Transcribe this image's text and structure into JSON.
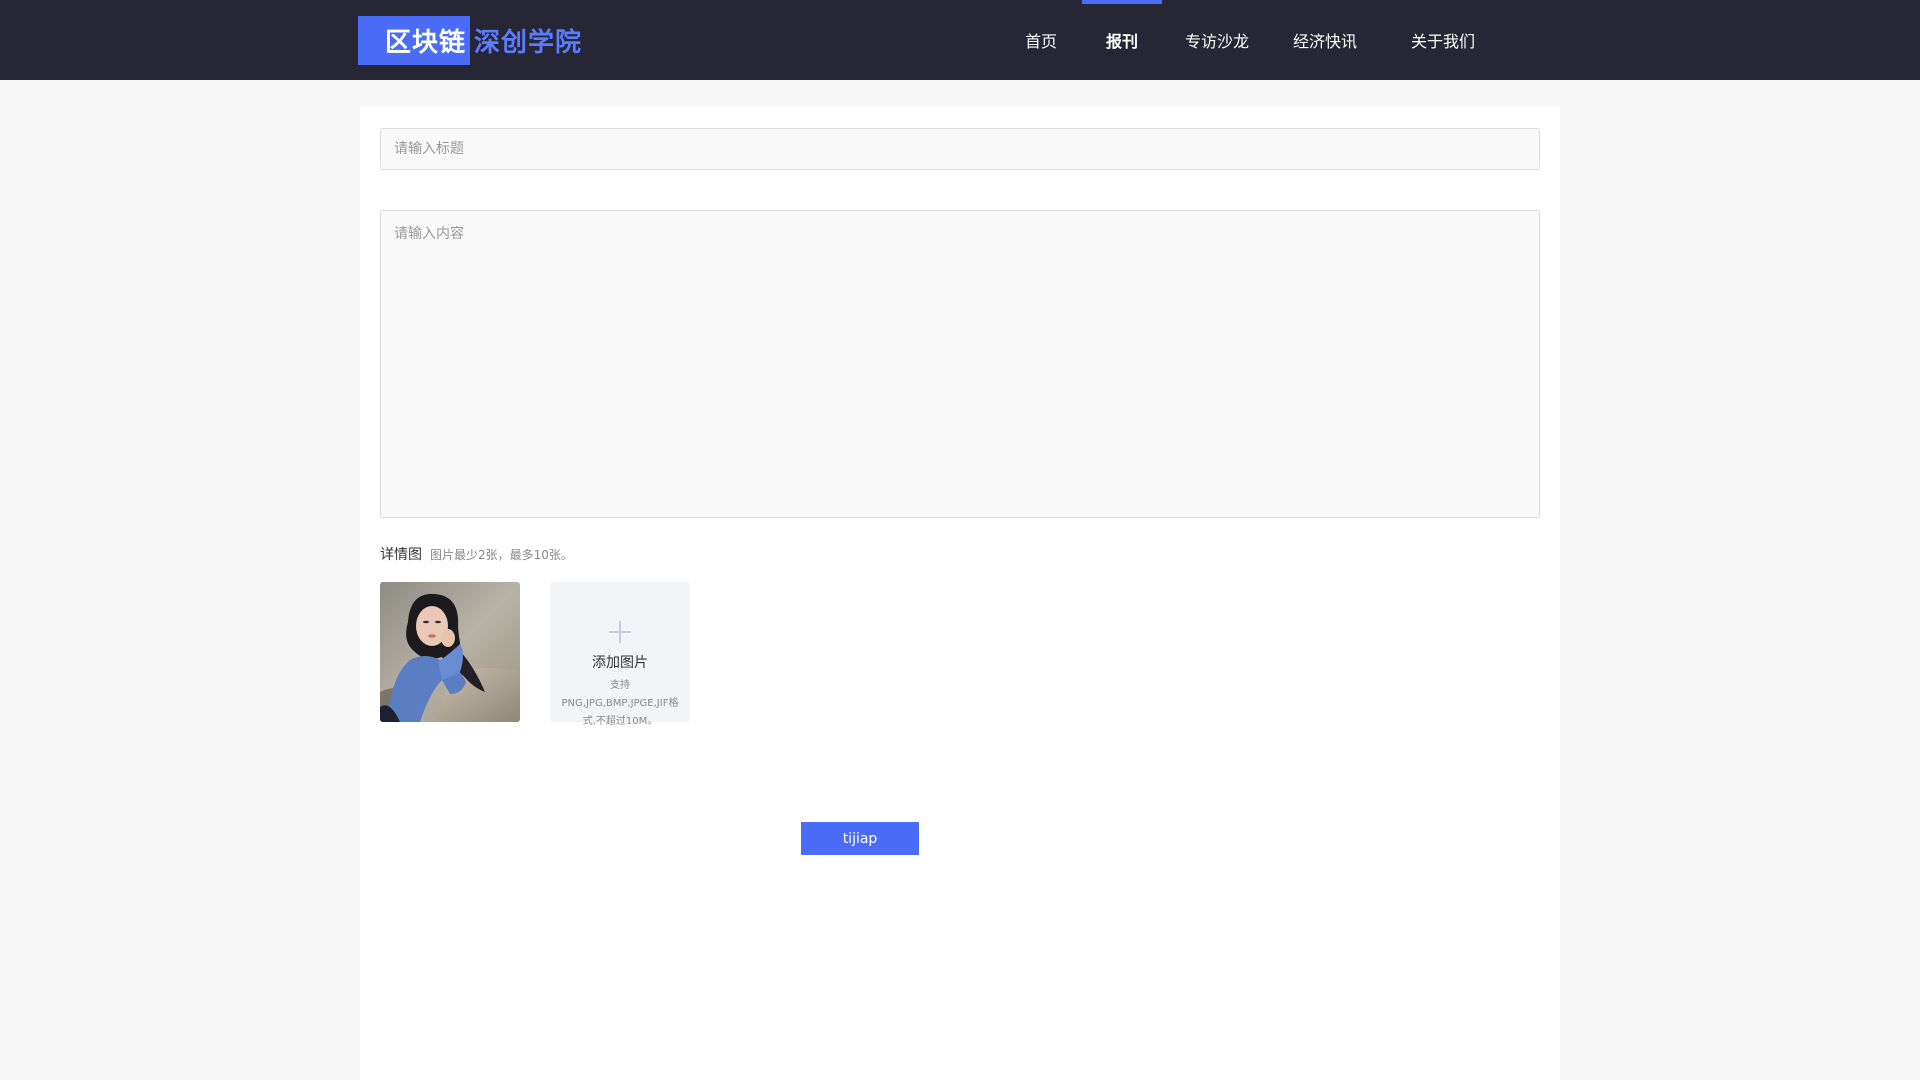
{
  "header": {
    "logo_main": "区块链",
    "logo_sub": "深创学院",
    "nav": [
      {
        "label": "首页",
        "active": false
      },
      {
        "label": "报刊",
        "active": true
      },
      {
        "label": "专访沙龙",
        "active": false
      },
      {
        "label": "经济快讯",
        "active": false
      },
      {
        "label": "关于我们",
        "active": false
      }
    ]
  },
  "form": {
    "title_placeholder": "请输入标题",
    "title_value": "",
    "content_placeholder": "请输入内容",
    "content_value": "",
    "detail_label": "详情图",
    "detail_hint": "图片最少2张，最多10张。",
    "upload_label": "添加图片",
    "upload_hint": "支持PNG,JPG,BMP,JPGE,JIF格式,不超过10M。",
    "submit_label": "tijiap"
  },
  "colors": {
    "accent": "#4a6cf7",
    "header_bg": "#262634"
  },
  "icons": {
    "upload": "plus-icon"
  }
}
